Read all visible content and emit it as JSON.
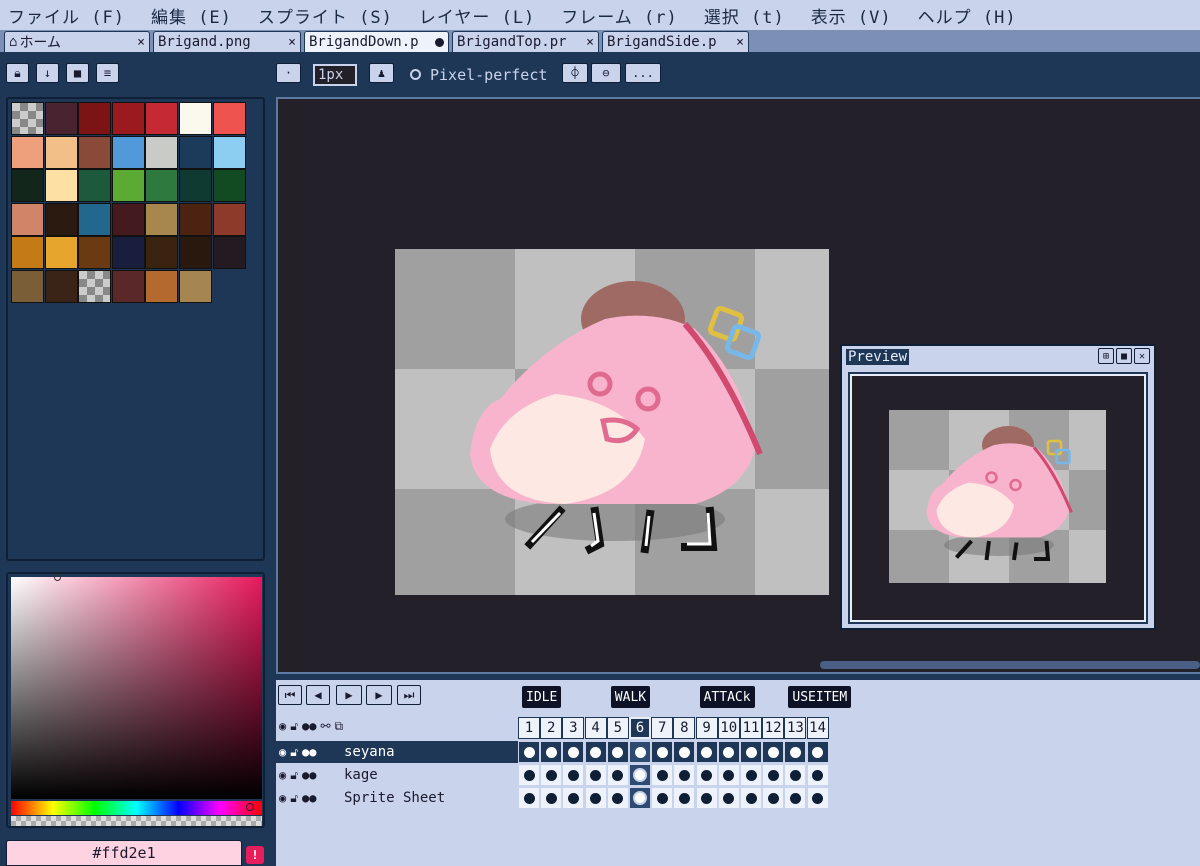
{
  "menu": [
    "ファイル (F)",
    "編集 (E)",
    "スプライト (S)",
    "レイヤー (L)",
    "フレーム (r)",
    "選択 (t)",
    "表示 (V)",
    "ヘルプ (H)"
  ],
  "tabs": [
    {
      "label": "ホーム",
      "width": 146,
      "active": false,
      "modified": false,
      "icon": true
    },
    {
      "label": "Brigand.png",
      "width": 148,
      "active": false,
      "modified": false
    },
    {
      "label": "BrigandDown.p",
      "width": 145,
      "active": true,
      "modified": true
    },
    {
      "label": "BrigandTop.pr",
      "width": 147,
      "active": false,
      "modified": false
    },
    {
      "label": "BrigandSide.p",
      "width": 147,
      "active": false,
      "modified": false
    }
  ],
  "toolbar": {
    "brush_size": "1px",
    "pixel_perfect": "Pixel-perfect",
    "more": "..."
  },
  "palette": [
    "checker",
    "#4a2330",
    "#7c1416",
    "#9a1a1e",
    "#c42a34",
    "#fbf8ee",
    "#ef5350",
    "#eea07c",
    "#f3bf88",
    "#8a4a3a",
    "#5199d8",
    "#c8cbc6",
    "#1c3a5a",
    "#8ccdf2",
    "#12261c",
    "#fde0a4",
    "#1d5a3c",
    "#5aaa34",
    "#2e7a3e",
    "#0f3a32",
    "#124a22",
    "#d08468",
    "#2a1a10",
    "#22688e",
    "#441a1e",
    "#a8874e",
    "#4c2210",
    "#8e3a2a",
    "#c47a16",
    "#e6a62e",
    "#6c3a12",
    "#1a1e3e",
    "#3a2410",
    "#28180e",
    "#241a22",
    "#7a5e38",
    "#3a2418",
    "checker",
    "#5a2828",
    "#b46a2e",
    "#a68650"
  ],
  "color_picker": {
    "hex": "#ffd2e1",
    "warning": "!"
  },
  "preview": {
    "title": "Preview"
  },
  "timeline": {
    "tags": [
      {
        "label": "IDLE",
        "frame": 1
      },
      {
        "label": "WALK",
        "frame": 5
      },
      {
        "label": "ATTACk",
        "frame": 9
      },
      {
        "label": "USEITEM",
        "frame": 13
      }
    ],
    "frames": [
      "1",
      "2",
      "3",
      "4",
      "5",
      "6",
      "7",
      "8",
      "9",
      "10",
      "11",
      "12",
      "13",
      "14"
    ],
    "current_frame": 6,
    "layers": [
      {
        "name": "seyana",
        "selected": true
      },
      {
        "name": "kage",
        "selected": false
      },
      {
        "name": "Sprite Sheet",
        "selected": false
      }
    ]
  },
  "colors": {
    "accent": "#1e3756",
    "hex_bg": "#ffd2e1",
    "warning": "#e81e5c"
  }
}
